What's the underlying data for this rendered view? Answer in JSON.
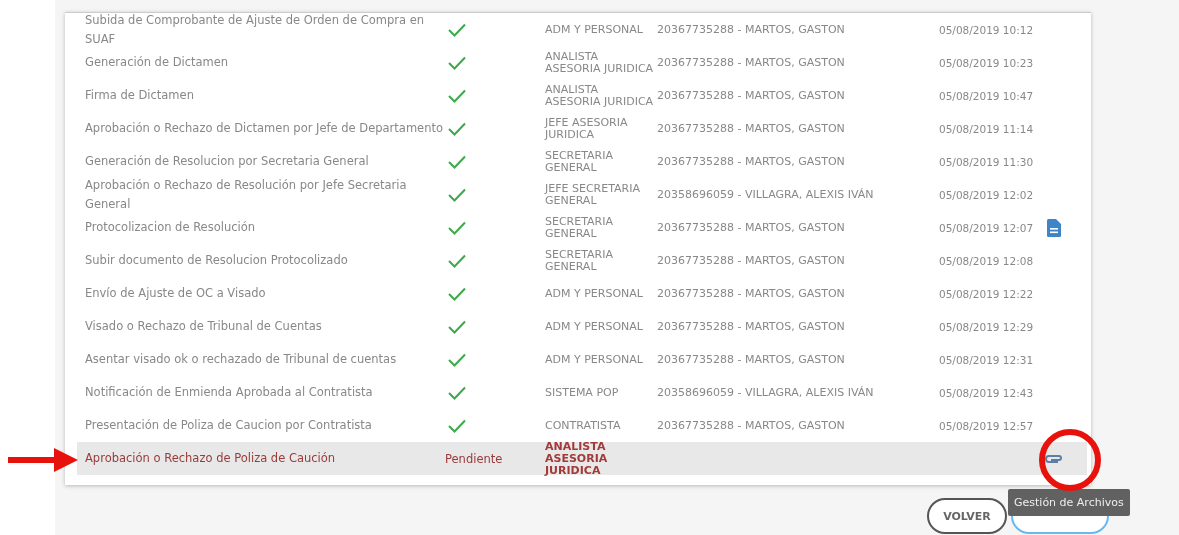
{
  "table": {
    "rows": [
      {
        "task": "Subida de Comprobante de Ajuste de Orden de Compra en SUAF",
        "status": {
          "kind": "done"
        },
        "area": "ADM Y PERSONAL",
        "user": "20367735288 - MARTOS, GASTON",
        "date": "05/08/2019 10:12",
        "selected": false
      },
      {
        "task": "Generación de Dictamen",
        "status": {
          "kind": "done"
        },
        "area": "ANALISTA ASESORIA JURIDICA",
        "user": "20367735288 - MARTOS, GASTON",
        "date": "05/08/2019 10:23",
        "selected": false
      },
      {
        "task": "Firma de Dictamen",
        "status": {
          "kind": "done"
        },
        "area": "ANALISTA ASESORIA JURIDICA",
        "user": "20367735288 - MARTOS, GASTON",
        "date": "05/08/2019 10:47",
        "selected": false
      },
      {
        "task": "Aprobación o Rechazo de Dictamen por Jefe de Departamento",
        "status": {
          "kind": "done"
        },
        "area": "JEFE ASESORIA JURIDICA",
        "user": "20367735288 - MARTOS, GASTON",
        "date": "05/08/2019 11:14",
        "selected": false
      },
      {
        "task": "Generación de Resolucion por Secretaria General",
        "status": {
          "kind": "done"
        },
        "area": "SECRETARIA GENERAL",
        "user": "20367735288 - MARTOS, GASTON",
        "date": "05/08/2019 11:30",
        "selected": false
      },
      {
        "task": "Aprobación o Rechazo de Resolución por Jefe Secretaria General",
        "status": {
          "kind": "done"
        },
        "area": "JEFE SECRETARIA GENERAL",
        "user": "20358696059 - VILLAGRA, ALEXIS IVÁN",
        "date": "05/08/2019 12:02",
        "selected": false
      },
      {
        "task": "Protocolizacion de Resolución",
        "status": {
          "kind": "done"
        },
        "area": "SECRETARIA GENERAL",
        "user": "20367735288 - MARTOS, GASTON",
        "date": "05/08/2019 12:07",
        "action": {
          "kind": "document"
        },
        "selected": false
      },
      {
        "task": "Subir documento de Resolucion Protocolizado",
        "status": {
          "kind": "done"
        },
        "area": "SECRETARIA GENERAL",
        "user": "20367735288 - MARTOS, GASTON",
        "date": "05/08/2019 12:08",
        "selected": false
      },
      {
        "task": "Envío de Ajuste de OC a Visado",
        "status": {
          "kind": "done"
        },
        "area": "ADM Y PERSONAL",
        "user": "20367735288 - MARTOS, GASTON",
        "date": "05/08/2019 12:22",
        "selected": false
      },
      {
        "task": "Visado o Rechazo de Tribunal de Cuentas",
        "status": {
          "kind": "done"
        },
        "area": "ADM Y PERSONAL",
        "user": "20367735288 - MARTOS, GASTON",
        "date": "05/08/2019 12:29",
        "selected": false
      },
      {
        "task": "Asentar visado ok o rechazado de Tribunal de cuentas",
        "status": {
          "kind": "done"
        },
        "area": "ADM Y PERSONAL",
        "user": "20367735288 - MARTOS, GASTON",
        "date": "05/08/2019 12:31",
        "selected": false
      },
      {
        "task": "Notificación de Enmienda Aprobada al Contratista",
        "status": {
          "kind": "done"
        },
        "area": "SISTEMA POP",
        "user": "20358696059 - VILLAGRA, ALEXIS IVÁN",
        "date": "05/08/2019 12:43",
        "selected": false
      },
      {
        "task": "Presentación de Poliza de Caucion por Contratista",
        "status": {
          "kind": "done"
        },
        "area": "CONTRATISTA",
        "user": "20367735288 - MARTOS, GASTON",
        "date": "05/08/2019 12:57",
        "selected": false
      },
      {
        "task": "Aprobación o Rechazo de Poliza de Caución",
        "status": {
          "kind": "pending",
          "label": "Pendiente"
        },
        "area": "ANALISTA ASESORIA JURIDICA",
        "action": {
          "kind": "attachment"
        },
        "selected": true
      }
    ]
  },
  "tooltip": "Gestión de Archivos",
  "buttons": [
    {
      "label": "VOLVER",
      "kind": "back"
    },
    {
      "kind": "reload"
    }
  ]
}
